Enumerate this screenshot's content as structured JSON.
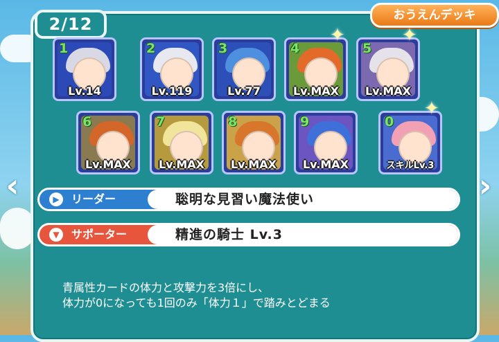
{
  "page_counter": "2/12",
  "deck_button_label": "おうえんデッキ",
  "cards_row1": [
    {
      "slot": "1",
      "level": "Lv.14",
      "hair": "#d9d9e6",
      "bg": "#2c49b8",
      "sparkle": false
    },
    {
      "slot": "2",
      "level": "Lv.119",
      "hair": "#e8e8f0",
      "bg": "#3157c4",
      "sparkle": false
    },
    {
      "slot": "3",
      "level": "Lv.77",
      "hair": "#4f8fe0",
      "bg": "#2d4fb8",
      "sparkle": false
    },
    {
      "slot": "4",
      "level": "Lv.MAX",
      "hair": "#e46a2a",
      "bg": "#6a9a3a",
      "sparkle": true
    },
    {
      "slot": "5",
      "level": "Lv.MAX",
      "hair": "#e5e2ea",
      "bg": "#7c69b0",
      "sparkle": true
    }
  ],
  "cards_row2": [
    {
      "slot": "6",
      "level": "Lv.MAX",
      "hair": "#d4662a",
      "bg": "#8a7a52",
      "sparkle": false
    },
    {
      "slot": "7",
      "level": "Lv.MAX",
      "hair": "#f0e59a",
      "bg": "#b59a3e",
      "sparkle": false
    },
    {
      "slot": "8",
      "level": "Lv.MAX",
      "hair": "#d8762c",
      "bg": "#c9a24a",
      "sparkle": false
    },
    {
      "slot": "9",
      "level": "Lv.MAX",
      "hair": "#3f6fd8",
      "bg": "#6c55c0",
      "sparkle": false
    },
    {
      "slot": "0",
      "level": "スキルLv.3",
      "hair": "#f2a1b4",
      "bg": "#4a6cd0",
      "sparkle": true
    }
  ],
  "leader": {
    "label": "リーダー",
    "value": "聡明な見習い魔法使い"
  },
  "supporter": {
    "label": "サポーター",
    "value": "精進の騎士 Lv.3"
  },
  "description": {
    "line1": "青属性カードの体力と攻撃力を3倍にし、",
    "line2": "体力が0になっても1回のみ「体力１」で踏みとどまる"
  },
  "nav": {
    "prev": "‹",
    "next": "›"
  },
  "icons": {
    "leader_icon": "play-circle-icon",
    "supporter_icon": "chevron-down-circle-icon",
    "sparkle": "sparkle-icon"
  }
}
